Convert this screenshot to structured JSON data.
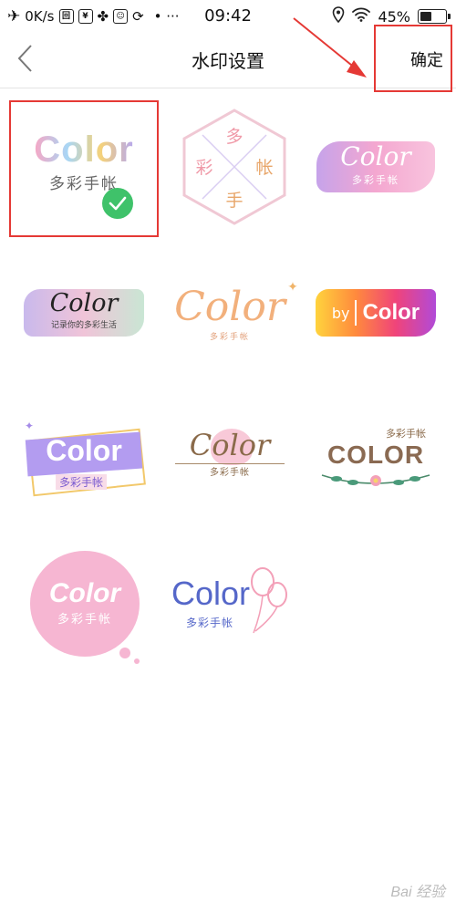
{
  "status_bar": {
    "net_speed": "0K/s",
    "time": "09:42",
    "dots": "• ···",
    "battery": "45%",
    "battery_level": 0.45
  },
  "nav": {
    "title": "水印设置",
    "confirm": "确定"
  },
  "watermarks": [
    {
      "main": "Color",
      "sub": "多彩手帐",
      "selected": true
    },
    {
      "main": "多彩手帐",
      "chars": [
        "多",
        "彩",
        "手",
        "帐"
      ]
    },
    {
      "main": "Color",
      "sub": "多彩手帐"
    },
    {
      "main": "Color",
      "sub": "记录你的多彩生活"
    },
    {
      "main": "Color",
      "sub": "多彩手帐"
    },
    {
      "main": "Color",
      "prefix": "by"
    },
    {
      "main": "Color",
      "sub": "多彩手帐"
    },
    {
      "main": "Color",
      "sub": "多彩手帐"
    },
    {
      "main": "COLOR",
      "sub": "多彩手帐"
    },
    {
      "main": "Color",
      "sub": "多彩手帐"
    },
    {
      "main": "Color",
      "sub": "多彩手帐"
    }
  ],
  "footer": {
    "text": "Bai 经验"
  },
  "colors": {
    "annotation": "#e53935",
    "check": "#3fc26a"
  }
}
